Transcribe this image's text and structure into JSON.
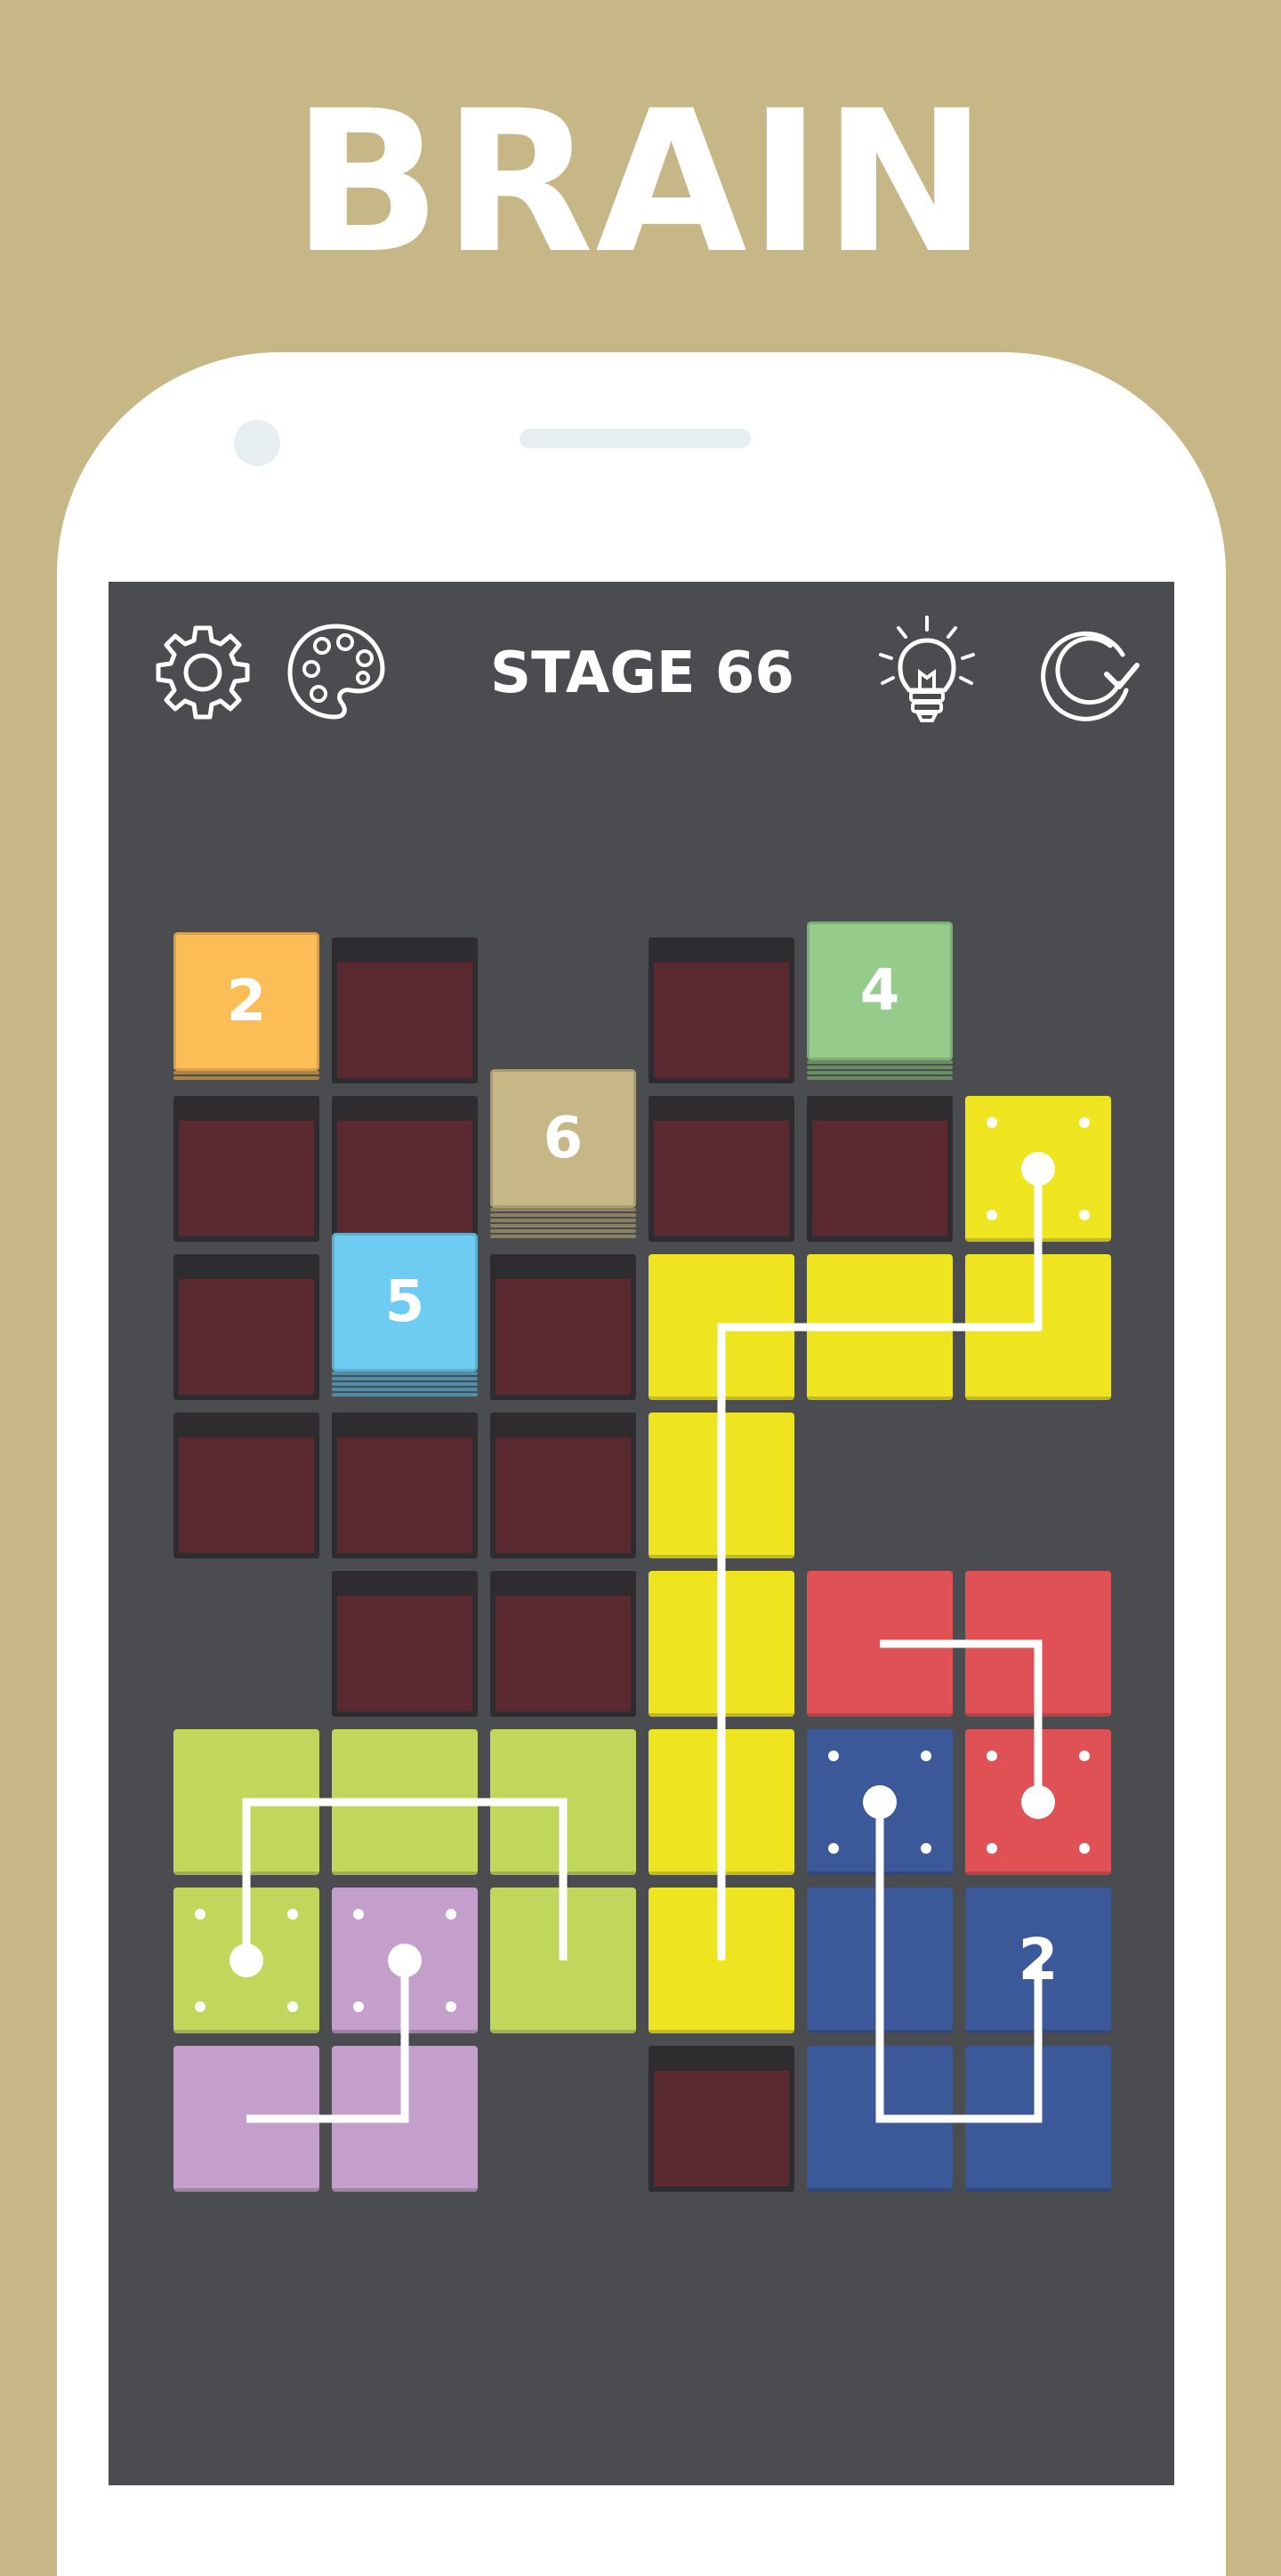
{
  "promo": {
    "title": "BRAIN"
  },
  "toolbar": {
    "stage_label": "STAGE 66",
    "settings_icon": "gear-icon",
    "theme_icon": "palette-icon",
    "hint_icon": "lightbulb-icon",
    "restart_icon": "restart-icon"
  },
  "colors": {
    "background": "#c7b787",
    "screen": "#4b4c4f",
    "hole_rim": "#2f2c30",
    "hole_pit": "#5b2a30",
    "yellow": "#eee41f",
    "lime": "#c1d75b",
    "purple": "#c49fcb",
    "red": "#e05155",
    "blue": "#3b5898",
    "orange": "#fcbd56",
    "mint": "#95cc8c",
    "tan": "#c7b787",
    "sky": "#6ecbf2"
  },
  "board": {
    "columns": 6,
    "rows": 8,
    "holes": [
      [
        0,
        1
      ],
      [
        0,
        3
      ],
      [
        1,
        0
      ],
      [
        1,
        1
      ],
      [
        1,
        3
      ],
      [
        1,
        4
      ],
      [
        2,
        0
      ],
      [
        2,
        2
      ],
      [
        3,
        0
      ],
      [
        3,
        1
      ],
      [
        3,
        2
      ],
      [
        4,
        1
      ],
      [
        4,
        2
      ],
      [
        7,
        3
      ]
    ],
    "number_tiles": [
      {
        "row": 0,
        "col": 0,
        "value": "2",
        "color": "orange",
        "layers": 2
      },
      {
        "row": 0,
        "col": 4,
        "value": "4",
        "color": "mint",
        "layers": 4
      },
      {
        "row": 1,
        "col": 2,
        "value": "6",
        "color": "tan",
        "layers": 6
      },
      {
        "row": 2,
        "col": 1,
        "value": "5",
        "color": "sky",
        "layers": 5
      }
    ],
    "blocks": [
      {
        "row": 1,
        "col": 5,
        "color": "yellow",
        "source": true
      },
      {
        "row": 2,
        "col": 3,
        "color": "yellow"
      },
      {
        "row": 2,
        "col": 4,
        "color": "yellow"
      },
      {
        "row": 2,
        "col": 5,
        "color": "yellow"
      },
      {
        "row": 3,
        "col": 3,
        "color": "yellow"
      },
      {
        "row": 4,
        "col": 3,
        "color": "yellow"
      },
      {
        "row": 5,
        "col": 3,
        "color": "yellow"
      },
      {
        "row": 6,
        "col": 3,
        "color": "yellow"
      },
      {
        "row": 4,
        "col": 4,
        "color": "red"
      },
      {
        "row": 4,
        "col": 5,
        "color": "red"
      },
      {
        "row": 5,
        "col": 5,
        "color": "red",
        "source": true
      },
      {
        "row": 5,
        "col": 4,
        "color": "blue",
        "source": true
      },
      {
        "row": 6,
        "col": 4,
        "color": "blue"
      },
      {
        "row": 6,
        "col": 5,
        "color": "blue",
        "number": "2"
      },
      {
        "row": 7,
        "col": 4,
        "color": "blue"
      },
      {
        "row": 7,
        "col": 5,
        "color": "blue"
      },
      {
        "row": 5,
        "col": 0,
        "color": "lime"
      },
      {
        "row": 5,
        "col": 1,
        "color": "lime"
      },
      {
        "row": 5,
        "col": 2,
        "color": "lime"
      },
      {
        "row": 6,
        "col": 0,
        "color": "lime",
        "source": true
      },
      {
        "row": 6,
        "col": 2,
        "color": "lime"
      },
      {
        "row": 6,
        "col": 1,
        "color": "purple",
        "source": true
      },
      {
        "row": 7,
        "col": 0,
        "color": "purple"
      },
      {
        "row": 7,
        "col": 1,
        "color": "purple"
      }
    ],
    "paths": [
      {
        "color": "yellow",
        "cells": [
          [
            1,
            5
          ],
          [
            2,
            5
          ],
          [
            2,
            3
          ],
          [
            6,
            3
          ]
        ]
      },
      {
        "color": "red",
        "cells": [
          [
            5,
            5
          ],
          [
            4,
            5
          ],
          [
            4,
            4
          ]
        ]
      },
      {
        "color": "blue",
        "cells": [
          [
            5,
            4
          ],
          [
            7,
            4
          ],
          [
            7,
            5
          ],
          [
            6,
            5
          ]
        ]
      },
      {
        "color": "lime",
        "cells": [
          [
            6,
            0
          ],
          [
            5,
            0
          ],
          [
            5,
            2
          ],
          [
            6,
            2
          ]
        ]
      },
      {
        "color": "purple",
        "cells": [
          [
            6,
            1
          ],
          [
            7,
            1
          ],
          [
            7,
            0
          ]
        ]
      }
    ]
  }
}
